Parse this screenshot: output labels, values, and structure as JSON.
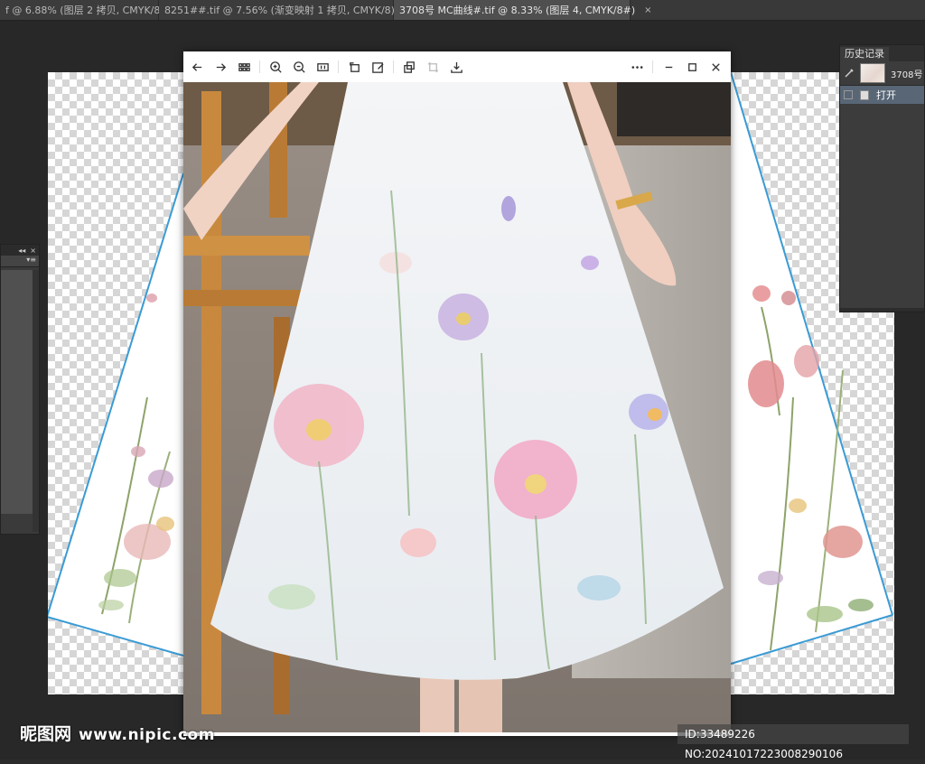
{
  "tabs": [
    {
      "title": "f @ 6.88% (图层 2 拷贝, CMYK/8)",
      "close": "×"
    },
    {
      "title": "8251##.tif @ 7.56% (渐变映射 1 拷贝, CMYK/8) *",
      "close": "×"
    },
    {
      "title": "3708号   MC曲线#.tif @ 8.33% (图层 4, CMYK/8#)",
      "close": "×"
    }
  ],
  "left_panel": {
    "collapse": "◂◂",
    "close": "×",
    "menu": "▾≡"
  },
  "history_panel": {
    "tab": "历史记录",
    "snapshot_label": "3708号",
    "steps": [
      "打开"
    ]
  },
  "viewer": {
    "toolbar": [
      "back-icon",
      "forward-icon",
      "grid-icon",
      "zoom-in-icon",
      "zoom-out-icon",
      "actual-size-icon",
      "rotate-icon",
      "edit-icon",
      "copy-icon",
      "crop-icon",
      "save-icon",
      "more-icon",
      "minimize-icon",
      "maximize-icon",
      "close-icon"
    ]
  },
  "colors": {
    "guide_line": "#3a9bd5",
    "canvas_bg": "#282828",
    "history_selected": "#586676"
  },
  "watermark": {
    "logo_cn": "昵图网",
    "logo_url": "www.nipic.com",
    "id_text": "ID:33489226 NO:20241017223008290106"
  }
}
